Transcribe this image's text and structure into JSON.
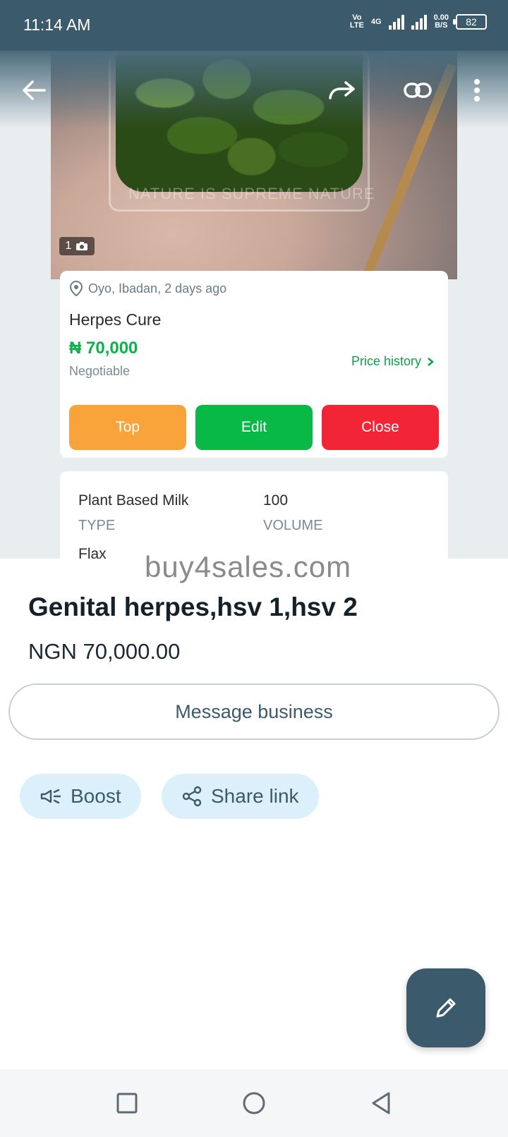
{
  "status": {
    "time": "11:14 AM",
    "volte": "Vo\nLTE",
    "network": "4G",
    "speed_value": "0.00",
    "speed_unit": "B/S",
    "battery": "82"
  },
  "listing": {
    "watermark": "NATURE IS SUPREME NATURE",
    "photo_count": "1",
    "location": "Oyo, Ibadan, 2 days ago",
    "title": "Herpes Cure",
    "price": "₦ 70,000",
    "negotiable": "Negotiable",
    "price_history": "Price history",
    "buttons": {
      "top": "Top",
      "edit": "Edit",
      "close": "Close"
    },
    "specs": [
      {
        "value": "Plant Based Milk",
        "key": "TYPE"
      },
      {
        "value": "100",
        "key": "VOLUME"
      }
    ],
    "spec_cut": "Flax"
  },
  "product": {
    "site": "buy4sales.com",
    "title": "Genital herpes,hsv 1,hsv 2",
    "price": "NGN 70,000.00",
    "message_button": "Message business",
    "boost": "Boost",
    "share_link": "Share link"
  },
  "colors": {
    "accent": "#3b5a6b",
    "green": "#08b946",
    "orange": "#f9a33b",
    "red": "#f22537",
    "pill_bg": "#dcf0fb"
  }
}
